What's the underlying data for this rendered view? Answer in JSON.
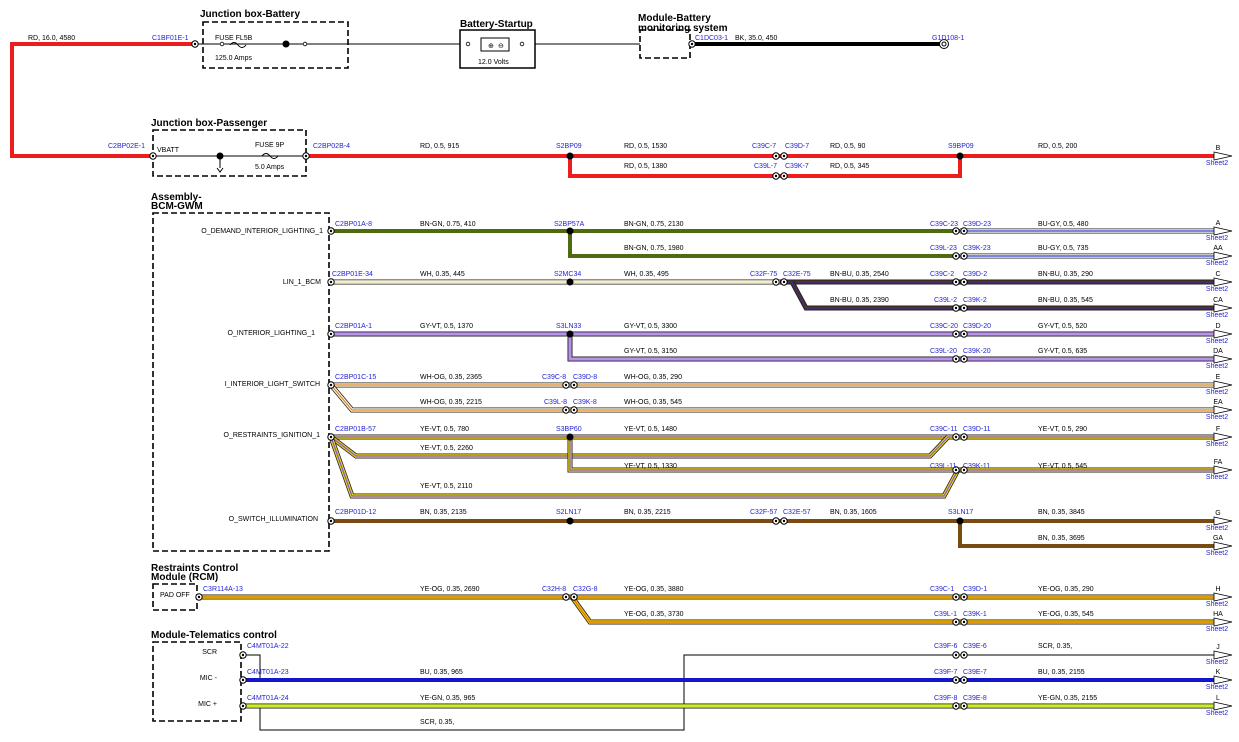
{
  "colors": {
    "RD": "#ee1c1c",
    "BK": "#000000",
    "BN-GN": "#4e6b10",
    "BU-GY": "#2b3fcf",
    "WH": "#fffbe8",
    "BN-BU": "#4a2f1a",
    "BU-BN": "#3c2d9a",
    "GY-VT": "#a47ad6",
    "WH-OG": "#e08a20",
    "YE-VT": "#e8d21a",
    "BN": "#7a4a12",
    "YE-OG": "#f2c400",
    "BU": "#1414c8",
    "YE-GN": "#b5e61d",
    "SCR": "#000000",
    "link": "#1f1fd6"
  },
  "components": {
    "jb_battery": {
      "title": "Junction box-Battery",
      "fuse": "FUSE FL5B",
      "rating": "125.0 Amps"
    },
    "battery": {
      "title": "Battery-Startup",
      "volts": "12.0 Volts"
    },
    "bms": {
      "title1": "Module-Battery",
      "title2": "monitoring system"
    },
    "jb_passenger": {
      "title": "Junction box-Passenger",
      "vbatt": "VBATT",
      "fuse": "FUSE 9P",
      "rating": "5.0 Amps"
    },
    "bcm": {
      "title1": "Assembly-",
      "title2": "BCM-GWM",
      "pins": [
        "O_DEMAND_INTERIOR_LIGHTING_1",
        "LIN_1_BCM",
        "O_INTERIOR_LIGHTING_1",
        "I_INTERIOR_LIGHT_SWITCH",
        "O_RESTRAINTS_IGNITION_1",
        "O_SWITCH_ILLUMINATION"
      ]
    },
    "rcm": {
      "title1": "Restraints Control",
      "title2": "Module (RCM)",
      "pin": "PAD OFF"
    },
    "telematics": {
      "title": "Module-Telematics control",
      "pins": [
        "SCR",
        "MIC -",
        "MIC +"
      ]
    }
  },
  "connectors": [
    "C1BF01E-1",
    "C1DC03-1",
    "G1D108-1",
    "C2BP02E-1",
    "C2BP02B-4",
    "S2BP09",
    "C39C-7",
    "C39D-7",
    "C39L-7",
    "C39K-7",
    "S9BP09",
    "C2BP01A-8",
    "S2BP57A",
    "C39C-23",
    "C39D-23",
    "C39L-23",
    "C39K-23",
    "C2BP01E-34",
    "S2MC34",
    "C32F-75",
    "C32E-75",
    "C39C-2",
    "C39D-2",
    "C39L-2",
    "C39K-2",
    "C2BP01A-1",
    "S3LN33",
    "C39C-20",
    "C39D-20",
    "C39L-20",
    "C39K-20",
    "C2BP01C-15",
    "C39C-8",
    "C39D-8",
    "C39L-8",
    "C39K-8",
    "C2BP01B-57",
    "S3BP60",
    "C39C-11",
    "C39D-11",
    "C39L-11",
    "C39K-11",
    "C2BP01D-12",
    "S2LN17",
    "C32F-57",
    "C32E-57",
    "S3LN17",
    "C3R114A-13",
    "C32H-8",
    "C32G-8",
    "C39C-1",
    "C39D-1",
    "C39L-1",
    "C39K-1",
    "C4MT01A-22",
    "C4MT01A-23",
    "C4MT01A-24",
    "C39F-6",
    "C39E-6",
    "C39F-7",
    "C39E-7",
    "C39F-8",
    "C39E-8"
  ],
  "wire_labels": [
    "RD, 16.0, 4580",
    "BK, 35.0, 450",
    "RD, 0.5, 915",
    "RD, 0.5, 1530",
    "RD, 0.5, 90",
    "RD, 0.5, 200",
    "RD, 0.5, 1380",
    "RD, 0.5, 345",
    "BN-GN, 0.75, 410",
    "BN-GN, 0.75, 2130",
    "BU-GY, 0.5, 480",
    "BN-GN, 0.75, 1980",
    "BU-GY, 0.5, 735",
    "WH, 0.35, 445",
    "WH, 0.35, 495",
    "BN-BU, 0.35, 2540",
    "BN-BU, 0.35, 290",
    "BN-BU, 0.35, 2390",
    "BN-BU, 0.35, 545",
    "GY-VT, 0.5, 1370",
    "GY-VT, 0.5, 3300",
    "GY-VT, 0.5, 520",
    "GY-VT, 0.5, 3150",
    "GY-VT, 0.5, 635",
    "WH-OG, 0.35, 2365",
    "WH-OG, 0.35, 290",
    "WH-OG, 0.35, 2215",
    "WH-OG, 0.35, 545",
    "YE-VT, 0.5, 780",
    "YE-VT, 0.5, 1480",
    "YE-VT, 0.5, 290",
    "YE-VT, 0.5, 2260",
    "YE-VT, 0.5, 1330",
    "YE-VT, 0.5, 545",
    "YE-VT, 0.5, 2110",
    "BN, 0.35, 2135",
    "BN, 0.35, 2215",
    "BN, 0.35, 1605",
    "BN, 0.35, 3845",
    "BN, 0.35, 3695",
    "YE-OG, 0.35, 2690",
    "YE-OG, 0.35, 3880",
    "YE-OG, 0.35, 290",
    "YE-OG, 0.35, 3730",
    "YE-OG, 0.35, 545",
    "SCR, 0.35,",
    "BU, 0.35, 965",
    "BU, 0.35, 2155",
    "YE-GN, 0.35, 965",
    "YE-GN, 0.35, 2155",
    "SCR, 0.35,"
  ],
  "offpage": [
    {
      "letter": "B",
      "sheet": "Sheet2"
    },
    {
      "letter": "A",
      "sheet": "Sheet2"
    },
    {
      "letter": "AA",
      "sheet": "Sheet2"
    },
    {
      "letter": "C",
      "sheet": "Sheet2"
    },
    {
      "letter": "CA",
      "sheet": "Sheet2"
    },
    {
      "letter": "D",
      "sheet": "Sheet2"
    },
    {
      "letter": "DA",
      "sheet": "Sheet2"
    },
    {
      "letter": "E",
      "sheet": "Sheet2"
    },
    {
      "letter": "EA",
      "sheet": "Sheet2"
    },
    {
      "letter": "F",
      "sheet": "Sheet2"
    },
    {
      "letter": "FA",
      "sheet": "Sheet2"
    },
    {
      "letter": "G",
      "sheet": "Sheet2"
    },
    {
      "letter": "GA",
      "sheet": "Sheet2"
    },
    {
      "letter": "H",
      "sheet": "Sheet2"
    },
    {
      "letter": "HA",
      "sheet": "Sheet2"
    },
    {
      "letter": "J",
      "sheet": "Sheet2"
    },
    {
      "letter": "K",
      "sheet": "Sheet2"
    },
    {
      "letter": "L",
      "sheet": "Sheet2"
    }
  ]
}
